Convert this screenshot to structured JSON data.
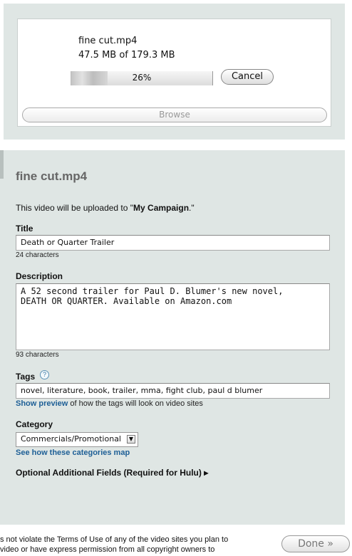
{
  "upload": {
    "file_name": "fine cut.mp4",
    "size_text": "47.5 MB of 179.3 MB",
    "progress_percent": 26,
    "progress_label": "26%",
    "cancel_label": "Cancel",
    "browse_label": "Browse"
  },
  "form": {
    "title": "fine cut.mp4",
    "upload_note_prefix": "This video will be uploaded to \"",
    "campaign": "My Campaign",
    "upload_note_suffix": ".\"",
    "title_label": "Title",
    "title_value": "Death or Quarter Trailer",
    "title_count": "24 characters",
    "description_label": "Description",
    "description_value": "A 52 second trailer for Paul D. Blumer's new novel,\nDEATH OR QUARTER. Available on Amazon.com",
    "description_count": "93 characters",
    "tags_label": "Tags",
    "help_icon_glyph": "?",
    "tags_value": "novel, literature, book, trailer, mma, fight club, paul d blumer",
    "show_preview_link": "Show preview",
    "show_preview_rest": " of how the tags will look on video sites",
    "category_label": "Category",
    "category_selected": "Commercials/Promotional",
    "category_arrow": "▼",
    "categories_link": "See how these categories map",
    "optional_fields": "Optional Additional Fields (Required for Hulu) ▸"
  },
  "footer": {
    "tos_line1": "s not violate the Terms of Use of any of the video sites you plan to",
    "tos_line2": "video or have express permission from all copyright owners to",
    "done_label": "Done »"
  },
  "colors": {
    "panel_bg": "#dfe6e4",
    "link": "#1e5f96"
  }
}
